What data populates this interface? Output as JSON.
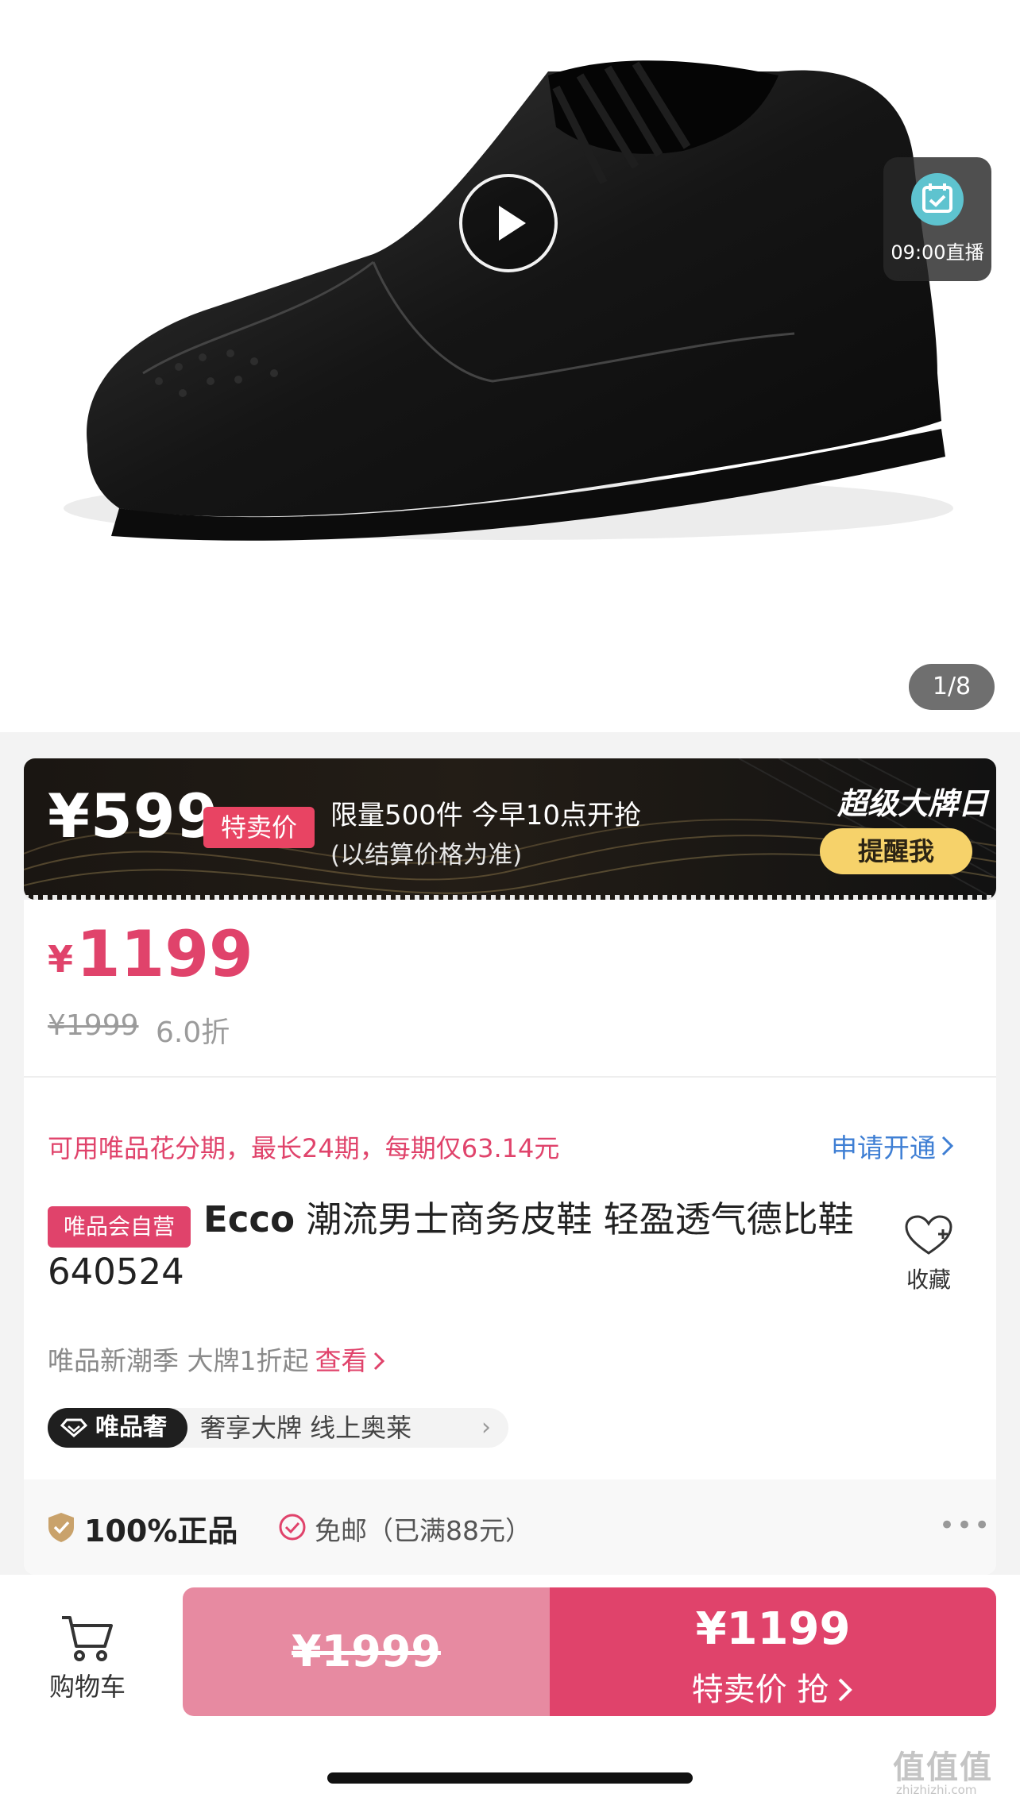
{
  "gallery": {
    "live_time": "09:00直播",
    "pager": "1/8"
  },
  "promo": {
    "price": "¥599",
    "tag": "特卖价",
    "line1": "限量500件 今早10点开抢",
    "line2": "(以结算价格为准)",
    "event": "超级大牌日",
    "remind_label": "提醒我"
  },
  "price": {
    "currency": "¥",
    "current": "1199",
    "original": "¥1999",
    "discount": "6.0折"
  },
  "installment": {
    "text": "可用唯品花分期，最长24期，每期仅63.14元",
    "action": "申请开通"
  },
  "product": {
    "self_tag": "唯品会自营",
    "brand": "Ecco",
    "title": " 潮流男士商务皮鞋 轻盈透气德比鞋640524",
    "favorite_label": "收藏"
  },
  "new_season": {
    "text": "唯品新潮季 大牌1折起",
    "link": "查看"
  },
  "luxury": {
    "badge": "唯品奢",
    "text": "奢享大牌  线上奥莱"
  },
  "guarantee": {
    "genuine": "100%正品",
    "shipping": "免邮（已满88元）",
    "more": "•••"
  },
  "bottom_bar": {
    "cart_label": "购物车",
    "original_price": "¥1999",
    "buy_price": "¥1199",
    "buy_label": "特卖价 抢"
  },
  "watermark": {
    "main": "值值值",
    "sub": "zhizhizhi.com"
  },
  "colors": {
    "accent": "#e0436b",
    "accent_light": "#e78aa1",
    "link_blue": "#3f7fd4",
    "gold": "#f6d26a"
  }
}
